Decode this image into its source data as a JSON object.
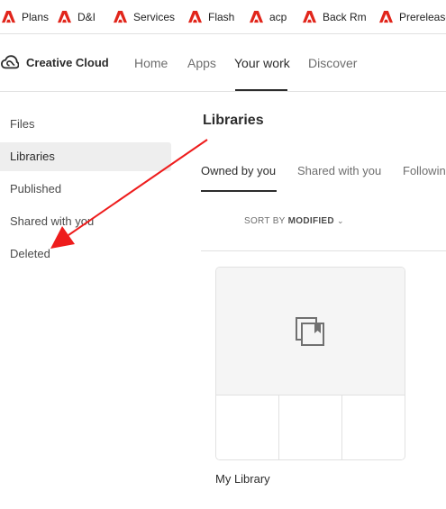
{
  "bookmarks": [
    {
      "label": "Plans",
      "icon": "adobe-icon"
    },
    {
      "label": "D&I",
      "icon": "adobe-icon"
    },
    {
      "label": "Services",
      "icon": "adobe-icon"
    },
    {
      "label": "Flash",
      "icon": "adobe-icon"
    },
    {
      "label": "acp",
      "icon": "adobe-icon"
    },
    {
      "label": "Back Rm",
      "icon": "adobe-icon"
    },
    {
      "label": "Prerelease",
      "icon": "adobe-icon"
    }
  ],
  "header": {
    "brand": "Creative Cloud",
    "nav": [
      "Home",
      "Apps",
      "Your work",
      "Discover"
    ],
    "active_nav": "Your work"
  },
  "sidebar": {
    "items": [
      {
        "label": "Files"
      },
      {
        "label": "Libraries"
      },
      {
        "label": "Published"
      },
      {
        "label": "Shared with you"
      },
      {
        "label": "Deleted"
      }
    ],
    "active": "Libraries"
  },
  "main": {
    "title": "Libraries",
    "tabs": [
      {
        "label": "Owned by you"
      },
      {
        "label": "Shared with you"
      },
      {
        "label": "Following"
      }
    ],
    "active_tab": "Owned by you",
    "sort": {
      "label": "SORT BY",
      "value": "MODIFIED"
    },
    "libraries": [
      {
        "name": "My Library"
      }
    ]
  },
  "colors": {
    "adobe_red": "#e1251b",
    "annotation_arrow": "#ee1c1c",
    "active_item_bg": "#eeeeee",
    "text_dark": "#2c2c2c",
    "text_muted": "#6e6e6e"
  }
}
